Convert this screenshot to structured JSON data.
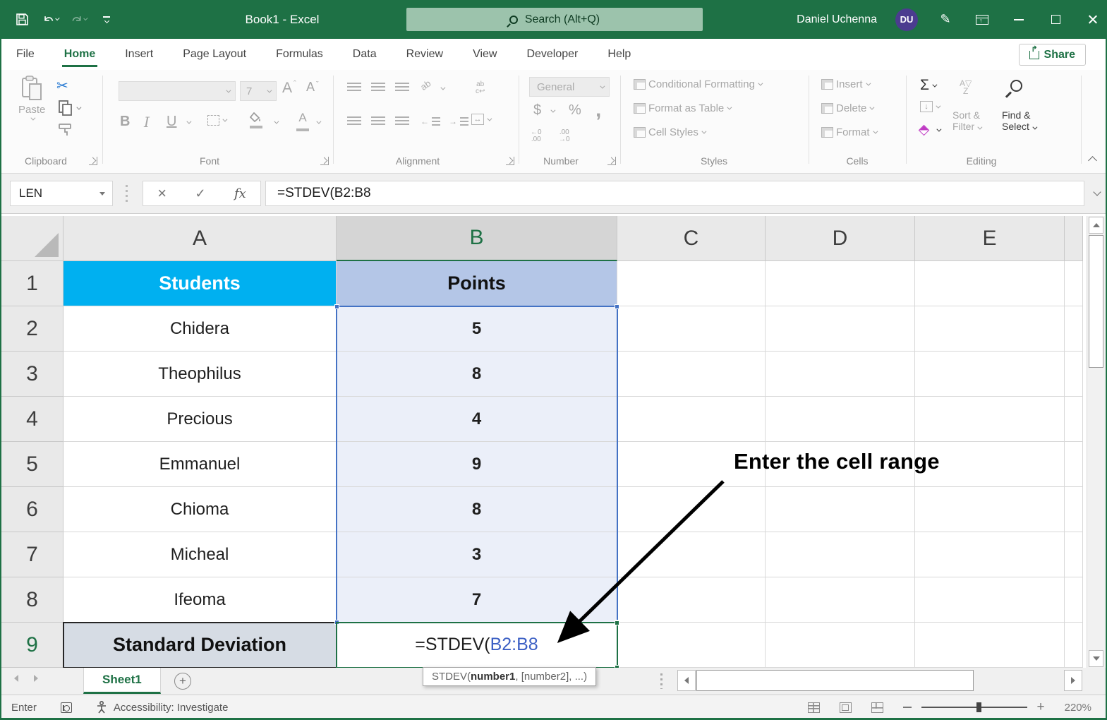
{
  "titlebar": {
    "title": "Book1  -  Excel",
    "search_placeholder": "Search (Alt+Q)",
    "user_name": "Daniel Uchenna",
    "user_initials": "DU"
  },
  "tabs": {
    "items": [
      "File",
      "Home",
      "Insert",
      "Page Layout",
      "Formulas",
      "Data",
      "Review",
      "View",
      "Developer",
      "Help"
    ],
    "active": "Home",
    "share_label": "Share"
  },
  "ribbon": {
    "clipboard": {
      "paste_label": "Paste",
      "group_label": "Clipboard"
    },
    "font": {
      "font_size_value": "7",
      "bold_label": "B",
      "italic_label": "I",
      "underline_label": "U",
      "group_label": "Font"
    },
    "alignment": {
      "orientation_label": "ab",
      "wrap_label": "ab",
      "group_label": "Alignment"
    },
    "number": {
      "format_value": "General",
      "currency": "$",
      "percent": "%",
      "comma": ",",
      "inc_top": "←0",
      "inc_bottom": ".00",
      "dec_top": ".00",
      "dec_bottom": "→0",
      "group_label": "Number"
    },
    "styles": {
      "items": [
        "Conditional Formatting",
        "Format as Table",
        "Cell Styles"
      ],
      "group_label": "Styles"
    },
    "cells": {
      "items": [
        "Insert",
        "Delete",
        "Format"
      ],
      "group_label": "Cells"
    },
    "editing": {
      "autosum": "Σ",
      "sort_line1": "Sort &",
      "sort_line2": "Filter",
      "sort_az1": "A",
      "sort_az2": "Z",
      "find_line1": "Find &",
      "find_line2": "Select",
      "group_label": "Editing"
    }
  },
  "formula_bar": {
    "name_box": "LEN",
    "cancel_glyph": "×",
    "enter_glyph": "✓",
    "fx_label": "fx",
    "formula": "=STDEV(B2:B8"
  },
  "grid": {
    "column_headers": [
      "A",
      "B",
      "C",
      "D",
      "E"
    ],
    "row1_num": "1",
    "header_row": {
      "a": "Students",
      "b": "Points"
    },
    "rows": [
      {
        "num": "2",
        "name": "Chidera",
        "points": "5"
      },
      {
        "num": "3",
        "name": "Theophilus",
        "points": "8"
      },
      {
        "num": "4",
        "name": "Precious",
        "points": "4"
      },
      {
        "num": "5",
        "name": "Emmanuel",
        "points": "9"
      },
      {
        "num": "6",
        "name": "Chioma",
        "points": "8"
      },
      {
        "num": "7",
        "name": "Micheal",
        "points": "3"
      },
      {
        "num": "8",
        "name": "Ifeoma",
        "points": "7"
      }
    ],
    "row9": {
      "num": "9",
      "label": "Standard Deviation",
      "formula_prefix": "=STDEV(",
      "formula_range": "B2:B8"
    },
    "colors": {
      "students_fill": "#00B0F0",
      "points_fill": "#B4C6E7",
      "selection_fill": "#EBEFF9",
      "selection_border": "#4472C4",
      "active_cell_border": "#1E7145",
      "stddev_fill": "#D6DCE4",
      "range_text": "#3B5FC4",
      "excel_green": "#1E7145"
    }
  },
  "annotation": {
    "text": "Enter the cell range"
  },
  "tooltip": {
    "prefix": "STDEV(",
    "arg1": "number1",
    "rest": ", [number2], ...)"
  },
  "sheet_bar": {
    "tab": "Sheet1",
    "add_glyph": "+"
  },
  "status_bar": {
    "mode": "Enter",
    "accessibility": "Accessibility: Investigate",
    "zoom": "220%"
  }
}
